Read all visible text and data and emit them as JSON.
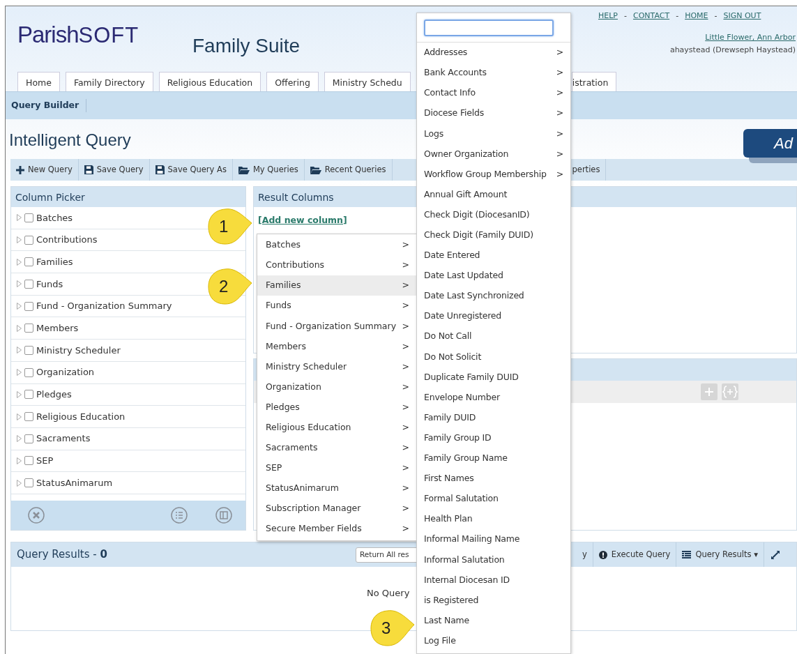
{
  "header": {
    "logo_main": "Parish",
    "logo_accent": "SOFT",
    "suite_title": "Family Suite",
    "top_links": [
      {
        "label": "HELP",
        "kind": "link"
      },
      {
        "label": "-",
        "kind": "separator"
      },
      {
        "label": "CONTACT",
        "kind": "link"
      },
      {
        "label": "-",
        "kind": "separator"
      },
      {
        "label": "HOME",
        "kind": "link"
      },
      {
        "label": "-",
        "kind": "separator"
      },
      {
        "label": "SIGN OUT",
        "kind": "link"
      }
    ],
    "parish_link": "Little Flower, Ann Arbor",
    "user": "ahaystead (Drewseph Haystead)"
  },
  "tabs": [
    {
      "label": "Home"
    },
    {
      "label": "Family Directory"
    },
    {
      "label": "Religious Education"
    },
    {
      "label": "Offering"
    },
    {
      "label": "Ministry Schedu"
    },
    {
      "label": "istration",
      "kind": "cut"
    }
  ],
  "subnav": {
    "label": "Query Builder"
  },
  "page_title": "Intelligent Query",
  "add_button": "Ad",
  "toolbar": [
    {
      "label": "New Query",
      "kind": "new"
    },
    {
      "label": "Save Query",
      "kind": "save"
    },
    {
      "label": "Save Query As",
      "kind": "save"
    },
    {
      "label": "My Queries",
      "kind": "open"
    },
    {
      "label": "Recent Queries",
      "kind": "open"
    },
    {
      "label": "perties",
      "kind": "cut"
    }
  ],
  "column_picker": {
    "title": "Column Picker",
    "items": [
      {
        "label": "Batches",
        "checked": false
      },
      {
        "label": "Contributions",
        "checked": false
      },
      {
        "label": "Families",
        "checked": false
      },
      {
        "label": "Funds",
        "checked": false
      },
      {
        "label": "Fund - Organization Summary",
        "checked": false
      },
      {
        "label": "Members",
        "checked": false
      },
      {
        "label": "Ministry Scheduler",
        "checked": false
      },
      {
        "label": "Organization",
        "checked": false
      },
      {
        "label": "Pledges",
        "checked": false
      },
      {
        "label": "Religious Education",
        "checked": false
      },
      {
        "label": "Sacraments",
        "checked": false
      },
      {
        "label": "SEP",
        "checked": false
      },
      {
        "label": "StatusAnimarum",
        "checked": false
      }
    ]
  },
  "result_columns": {
    "title": "Result Columns",
    "add_link": "[Add new column]"
  },
  "query_results": {
    "title": "Query Results - **0**",
    "buttons": [
      {
        "label": "Return All res",
        "kind": "cut"
      },
      {
        "label": "y",
        "kind": "cut-right"
      },
      {
        "label": "Execute Query",
        "kind": "execute"
      },
      {
        "label": "Query Results ▾",
        "kind": "list"
      }
    ],
    "empty_text": "No Query"
  },
  "table_menu": {
    "items": [
      {
        "label": "Batches",
        "arrow": ">",
        "selected": false
      },
      {
        "label": "Contributions",
        "arrow": ">",
        "selected": false
      },
      {
        "label": "Families",
        "arrow": ">",
        "selected": true
      },
      {
        "label": "Funds",
        "arrow": ">",
        "selected": false
      },
      {
        "label": "Fund - Organization Summary",
        "arrow": ">",
        "selected": false
      },
      {
        "label": "Members",
        "arrow": ">",
        "selected": false
      },
      {
        "label": "Ministry Scheduler",
        "arrow": ">",
        "selected": false
      },
      {
        "label": "Organization",
        "arrow": ">",
        "selected": false
      },
      {
        "label": "Pledges",
        "arrow": ">",
        "selected": false
      },
      {
        "label": "Religious Education",
        "arrow": ">",
        "selected": false
      },
      {
        "label": "Sacraments",
        "arrow": ">",
        "selected": false
      },
      {
        "label": "SEP",
        "arrow": ">",
        "selected": false
      },
      {
        "label": "StatusAnimarum",
        "arrow": ">",
        "selected": false
      },
      {
        "label": "Subscription Manager",
        "arrow": ">",
        "selected": false
      },
      {
        "label": "Secure Member Fields",
        "arrow": ">",
        "selected": false
      }
    ]
  },
  "field_menu": {
    "items": [
      {
        "label": "Addresses",
        "arrow": ">"
      },
      {
        "label": "Bank Accounts",
        "arrow": ">"
      },
      {
        "label": "Contact Info",
        "arrow": ">"
      },
      {
        "label": "Diocese Fields",
        "arrow": ">"
      },
      {
        "label": "Logs",
        "arrow": ">"
      },
      {
        "label": "Owner Organization",
        "arrow": ">"
      },
      {
        "label": "Workflow Group Membership",
        "arrow": ">"
      },
      {
        "label": "Annual Gift Amount"
      },
      {
        "label": "Check Digit (DiocesanID)"
      },
      {
        "label": "Check Digit (Family DUID)"
      },
      {
        "label": "Date Entered"
      },
      {
        "label": "Date Last Updated"
      },
      {
        "label": "Date Last Synchronized"
      },
      {
        "label": "Date Unregistered"
      },
      {
        "label": "Do Not Call"
      },
      {
        "label": "Do Not Solicit"
      },
      {
        "label": "Duplicate Family DUID"
      },
      {
        "label": "Envelope Number"
      },
      {
        "label": "Family DUID"
      },
      {
        "label": "Family Group ID"
      },
      {
        "label": "Family Group Name"
      },
      {
        "label": "First Names"
      },
      {
        "label": "Formal Salutation"
      },
      {
        "label": "Health Plan"
      },
      {
        "label": "Informal Mailing Name"
      },
      {
        "label": "Informal Salutation"
      },
      {
        "label": "Internal Diocesan ID"
      },
      {
        "label": "is Registered"
      },
      {
        "label": "Last Name"
      },
      {
        "label": "Log File"
      }
    ]
  },
  "callouts": [
    {
      "number": "1"
    },
    {
      "number": "2"
    },
    {
      "number": "3"
    }
  ]
}
